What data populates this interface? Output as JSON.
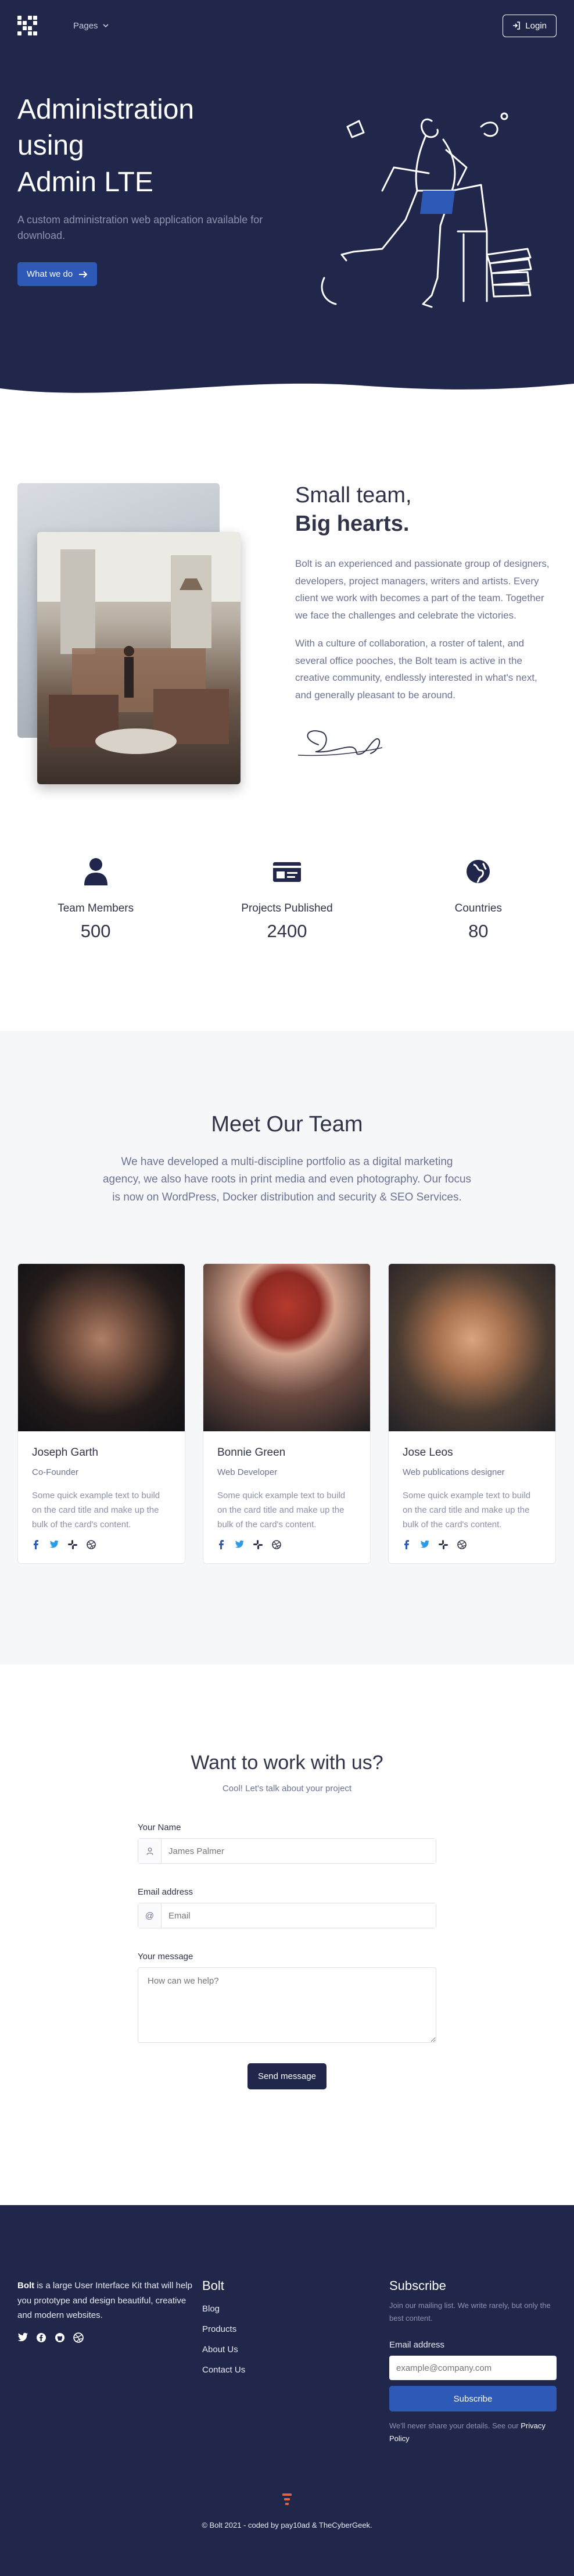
{
  "nav": {
    "pages_label": "Pages",
    "login_label": "Login"
  },
  "hero": {
    "title_line1": "Administration",
    "title_line2": "using",
    "title_line3": "Admin LTE",
    "description": "A custom administration web application available for download.",
    "cta_label": "What we do"
  },
  "about": {
    "heading_light": "Small team,",
    "heading_bold": "Big hearts.",
    "paragraph1": "Bolt is an experienced and passionate group of designers, developers, project managers, writers and artists. Every client we work with becomes a part of the team. Together we face the challenges and celebrate the victories.",
    "paragraph2": "With a culture of collaboration, a roster of talent, and several office pooches, the Bolt team is active in the creative community, endlessly interested in what's next, and generally pleasant to be around."
  },
  "stats": [
    {
      "icon": "user-icon",
      "label": "Team Members",
      "value": "500"
    },
    {
      "icon": "id-card-icon",
      "label": "Projects Published",
      "value": "2400"
    },
    {
      "icon": "globe-icon",
      "label": "Countries",
      "value": "80"
    }
  ],
  "team": {
    "title": "Meet Our Team",
    "lead": "We have developed a multi-discipline portfolio as a digital marketing agency, we also have roots in print media and even photography. Our focus is now on WordPress, Docker distribution and security & SEO Services.",
    "members": [
      {
        "name": "Joseph Garth",
        "role": "Co-Founder",
        "text": "Some quick example text to build on the card title and make up the bulk of the card's content."
      },
      {
        "name": "Bonnie Green",
        "role": "Web Developer",
        "text": "Some quick example text to build on the card title and make up the bulk of the card's content."
      },
      {
        "name": "Jose Leos",
        "role": "Web publications designer",
        "text": "Some quick example text to build on the card title and make up the bulk of the card's content."
      }
    ]
  },
  "contact": {
    "title": "Want to work with us?",
    "subtitle": "Cool! Let's talk about your project",
    "name_label": "Your Name",
    "name_placeholder": "James Palmer",
    "email_label": "Email address",
    "email_placeholder": "Email",
    "email_prefix": "@",
    "message_label": "Your message",
    "message_placeholder": "How can we help?",
    "send_label": "Send message"
  },
  "footer": {
    "brand_bold": "Bolt",
    "description": " is a large User Interface Kit that will help you prototype and design beautiful, creative and modern websites.",
    "links_title": "Bolt",
    "links": [
      "Blog",
      "Products",
      "About Us",
      "Contact Us"
    ],
    "subscribe_title": "Subscribe",
    "subscribe_text": "Join our mailing list. We write rarely, but only the best content.",
    "email_label": "Email address",
    "email_placeholder": "example@company.com",
    "subscribe_button": "Subscribe",
    "note_text": "We'll never share your details. See our ",
    "note_link": "Privacy Policy",
    "copyright": "© Bolt 2021 - coded by pay10ad & TheCyberGeek."
  },
  "colors": {
    "navy": "#20274a",
    "accent_blue": "#2f59b6",
    "light_section": "#f6f7f9"
  }
}
